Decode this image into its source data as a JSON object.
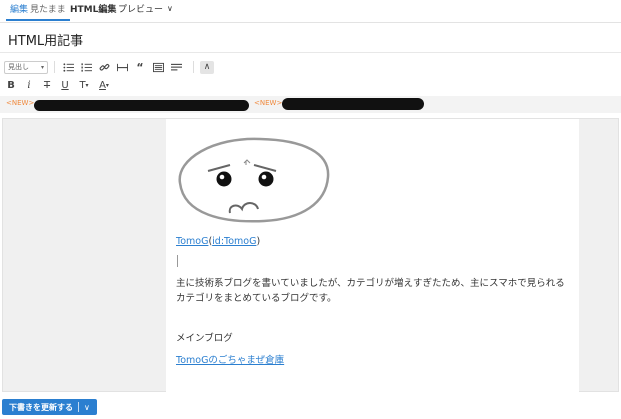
{
  "tabs": {
    "edit_label": "編集",
    "edit_sub": "見たまま",
    "html_label": "HTML編集",
    "preview_label": "プレビュー"
  },
  "title": {
    "value": "HTML用記事"
  },
  "toolbar": {
    "heading_value": "見出し",
    "row1_icons": [
      "bullet-list-icon",
      "numbered-list-icon",
      "link-icon",
      "horizontal-rule-icon",
      "blockquote-icon",
      "image-icon",
      "table-icon",
      "collapse-toolbar-icon"
    ],
    "bold": "B",
    "italic": "i",
    "strike": "T",
    "underline": "U",
    "text_size": "T",
    "text_color": "A"
  },
  "new_bar": {
    "new_label_1": "<NEW>",
    "new_label_2": "<NEW>"
  },
  "content": {
    "link1_text": "TomoG",
    "link1_id": "id:TomoG",
    "paragraph": "主に技術系ブログを書いていましたが、カテゴリが増えすぎたため、主にスマホで見られるカテゴリをまとめているブログです。",
    "heading": "メインブログ",
    "link2_text": "TomoGのごちゃまぜ倉庫"
  },
  "footer": {
    "update_label": "下書きを更新する"
  },
  "colors": {
    "accent": "#2b7fd0",
    "new": "#f08a3e"
  }
}
